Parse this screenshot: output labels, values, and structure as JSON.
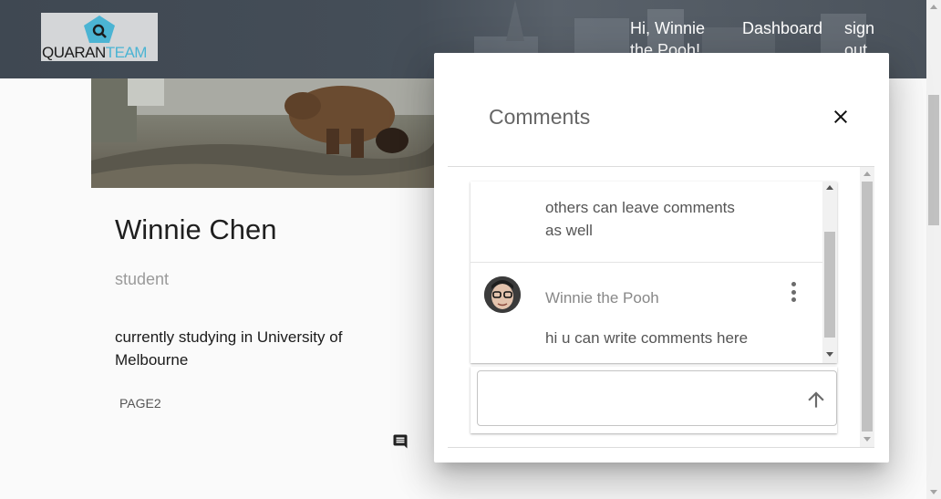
{
  "header": {
    "logo_text_dark": "QUARAN",
    "logo_text_light": "TEAM",
    "greeting": "Hi, Winnie the Pooh!",
    "dashboard_label": "Dashboard",
    "signout_label": "sign out"
  },
  "profile": {
    "name": "Winnie Chen",
    "role": "student",
    "bio": "currently studying in University of Melbourne",
    "page_link": "PAGE2"
  },
  "dialog": {
    "title": "Comments",
    "comments": [
      {
        "author": "",
        "text": "others can leave comments as well"
      },
      {
        "author": "Winnie the Pooh",
        "text": "hi u can write comments here"
      }
    ],
    "input_placeholder": ""
  },
  "colors": {
    "header_bg": "#454e58",
    "logo_accent": "#4bb4d3"
  },
  "icons": {
    "close": "close-icon",
    "more": "more-vert-icon",
    "send": "arrow-up-icon",
    "comment": "comment-icon"
  }
}
